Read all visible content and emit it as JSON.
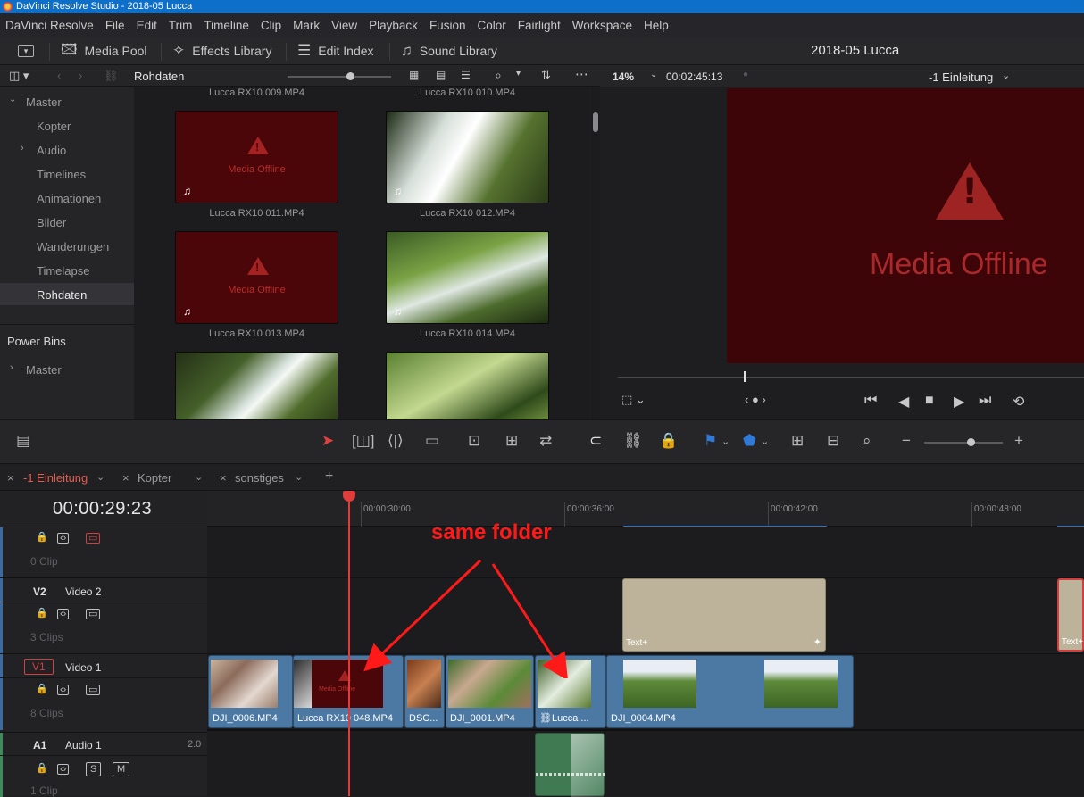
{
  "window": {
    "title": "DaVinci Resolve Studio - 2018-05 Lucca"
  },
  "menu": [
    "DaVinci Resolve",
    "File",
    "Edit",
    "Trim",
    "Timeline",
    "Clip",
    "Mark",
    "View",
    "Playback",
    "Fusion",
    "Color",
    "Fairlight",
    "Workspace",
    "Help"
  ],
  "toolbar": {
    "media_pool": "Media Pool",
    "effects_library": "Effects Library",
    "edit_index": "Edit Index",
    "sound_library": "Sound Library",
    "project_title": "2018-05 Lucca"
  },
  "media_pool": {
    "current_bin": "Rohdaten",
    "tree": [
      {
        "label": "Master"
      },
      {
        "label": "Kopter"
      },
      {
        "label": "Audio"
      },
      {
        "label": "Timelines"
      },
      {
        "label": "Animationen"
      },
      {
        "label": "Bilder"
      },
      {
        "label": "Wanderungen"
      },
      {
        "label": "Timelapse"
      },
      {
        "label": "Rohdaten"
      }
    ],
    "power_bins": "Power Bins",
    "power_master": "Master",
    "clips": [
      {
        "name": "Lucca  RX10 009.MP4"
      },
      {
        "name": "Lucca  RX10 010.MP4"
      },
      {
        "name": "Lucca  RX10 011.MP4",
        "offline": "Media Offline"
      },
      {
        "name": "Lucca  RX10 012.MP4"
      },
      {
        "name": "Lucca  RX10 013.MP4",
        "offline": "Media Offline"
      },
      {
        "name": "Lucca  RX10 014.MP4"
      }
    ]
  },
  "viewer": {
    "zoom": "14%",
    "timecode": "00:02:45:13",
    "timeline_name": "-1 Einleitung",
    "offline_text": "Media Offline"
  },
  "timeline": {
    "tabs": [
      {
        "label": "-1 Einleitung"
      },
      {
        "label": "Kopter"
      },
      {
        "label": "sonstiges"
      }
    ],
    "current_tc": "00:00:29:23",
    "ruler": [
      "00:00:30:00",
      "00:00:36:00",
      "00:00:42:00",
      "00:00:48:00"
    ],
    "tracks": {
      "v3_clips": "0 Clip",
      "v2_id": "V2",
      "v2_name": "Video 2",
      "v2_clips": "3 Clips",
      "v1_id": "V1",
      "v1_name": "Video 1",
      "v1_clips": "8 Clips",
      "a1_id": "A1",
      "a1_name": "Audio 1",
      "a1_level": "2.0",
      "a1_clips": "1 Clip",
      "solo": "S",
      "mute": "M"
    },
    "text_clip": "Text+",
    "v1_clips": [
      {
        "name": "DJI_0006.MP4"
      },
      {
        "name": "Lucca  RX10 048.MP4",
        "offline": "Media Offline"
      },
      {
        "name": "DSC..."
      },
      {
        "name": "DJI_0001.MP4"
      },
      {
        "name": "Lucca  ..."
      },
      {
        "name": "DJI_0004.MP4"
      }
    ]
  },
  "annotation": "same folder",
  "colors": {
    "accent_red": "#e03c3c",
    "offline_bg": "#4a0608",
    "clip_blue": "#4b79a3",
    "annotation": "#ff1a1a"
  }
}
